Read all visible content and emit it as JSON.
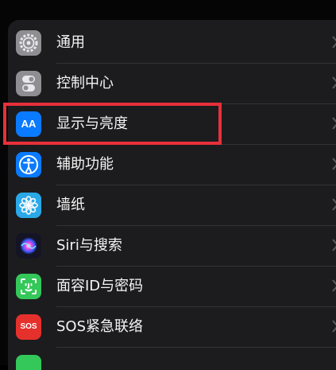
{
  "settings": {
    "items": [
      {
        "label": "通用",
        "icon": "gear-icon",
        "icon_color": "#8e8e93"
      },
      {
        "label": "控制中心",
        "icon": "toggles-icon",
        "icon_color": "#8e8e93"
      },
      {
        "label": "显示与亮度",
        "icon": "text-size-icon",
        "icon_color": "#0a7aff",
        "icon_text": "AA"
      },
      {
        "label": "辅助功能",
        "icon": "accessibility-icon",
        "icon_color": "#0a7aff"
      },
      {
        "label": "墙纸",
        "icon": "flower-icon",
        "icon_color": "#2aa8e8"
      },
      {
        "label": "Siri与搜索",
        "icon": "siri-icon",
        "icon_color": "#1a1a2e"
      },
      {
        "label": "面容ID与密码",
        "icon": "face-id-icon",
        "icon_color": "#34c759"
      },
      {
        "label": "SOS紧急联络",
        "icon": "sos-icon",
        "icon_color": "#e5302c",
        "icon_text": "SOS"
      }
    ]
  },
  "highlight_color": "#e8303a"
}
